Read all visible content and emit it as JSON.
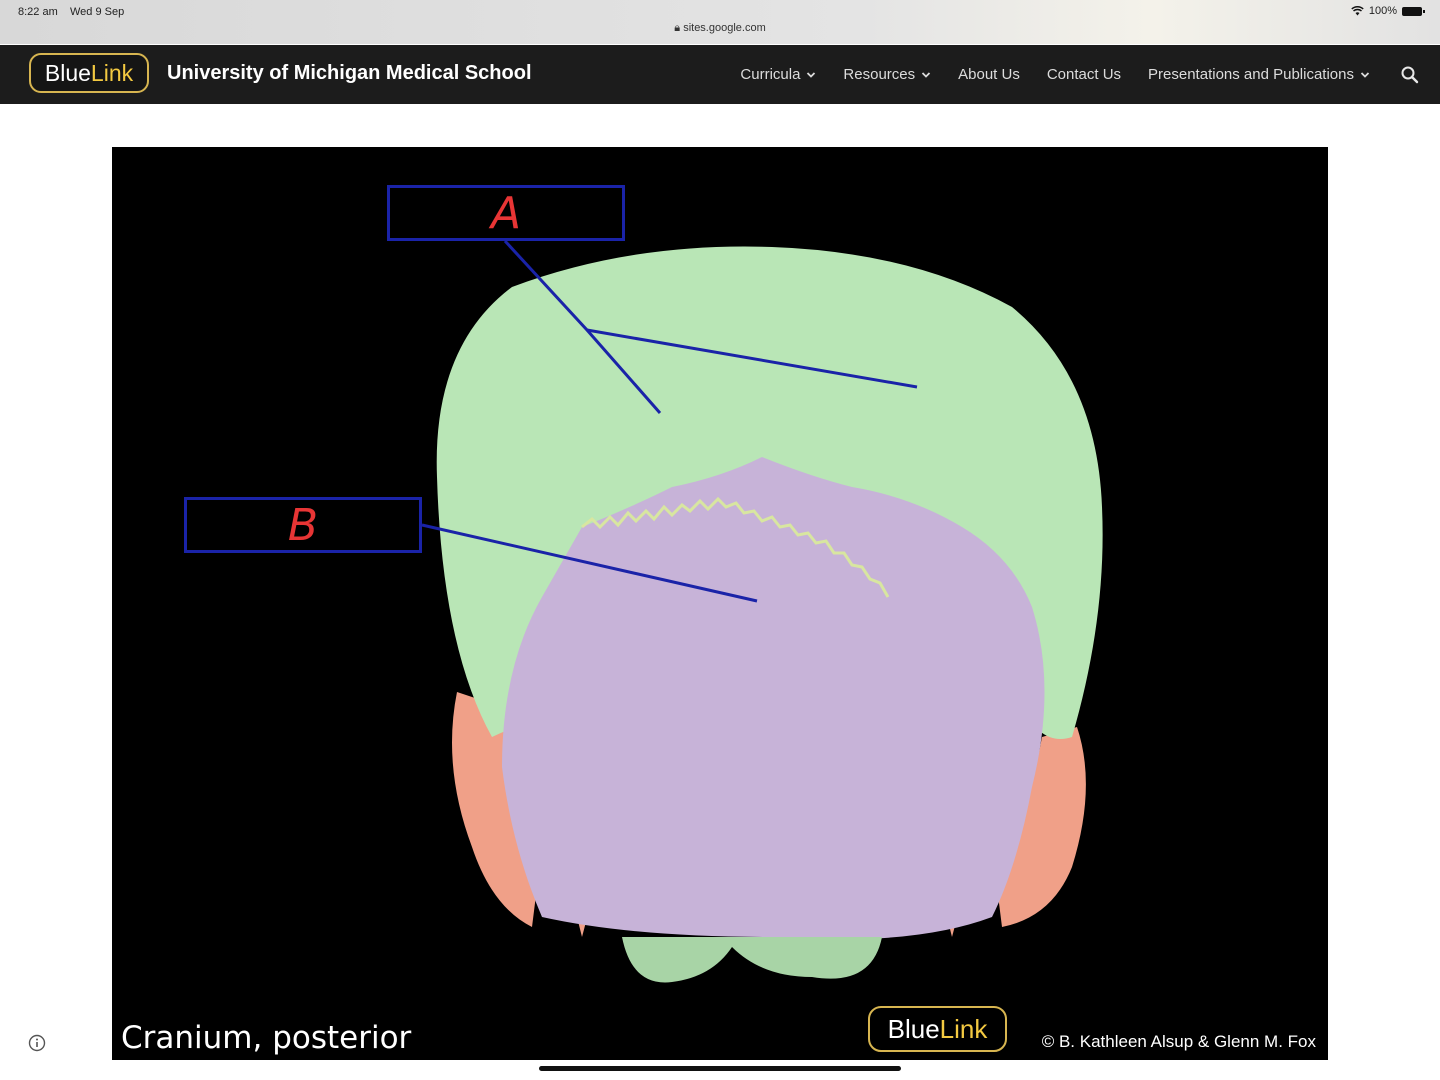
{
  "status_bar": {
    "time": "8:22 am",
    "date": "Wed 9 Sep",
    "url": "sites.google.com",
    "battery": "100%"
  },
  "site": {
    "logo_blue": "Blue",
    "logo_link": "Link",
    "name": "University of Michigan Medical School"
  },
  "nav": {
    "items": [
      {
        "label": "Curricula",
        "has_dropdown": true
      },
      {
        "label": "Resources",
        "has_dropdown": true
      },
      {
        "label": "About Us",
        "has_dropdown": false
      },
      {
        "label": "Contact Us",
        "has_dropdown": false
      },
      {
        "label": "Presentations and Publications",
        "has_dropdown": true
      }
    ],
    "search_icon": "search-icon"
  },
  "figure": {
    "caption": "Cranium, posterior",
    "label_a": "A",
    "label_b": "B",
    "logo_blue": "Blue",
    "logo_link": "Link",
    "copyright": "© B. Kathleen Alsup & Glenn M. Fox"
  },
  "colors": {
    "nav_bg": "#1c1c1c",
    "logo_gold": "#d7b550",
    "parietal_green": "#b9e6b6",
    "occipital_purple": "#c7b3d8",
    "temporal_orange": "#f0a088",
    "leader_line_blue": "#1a23a8",
    "label_red": "#e83535"
  }
}
